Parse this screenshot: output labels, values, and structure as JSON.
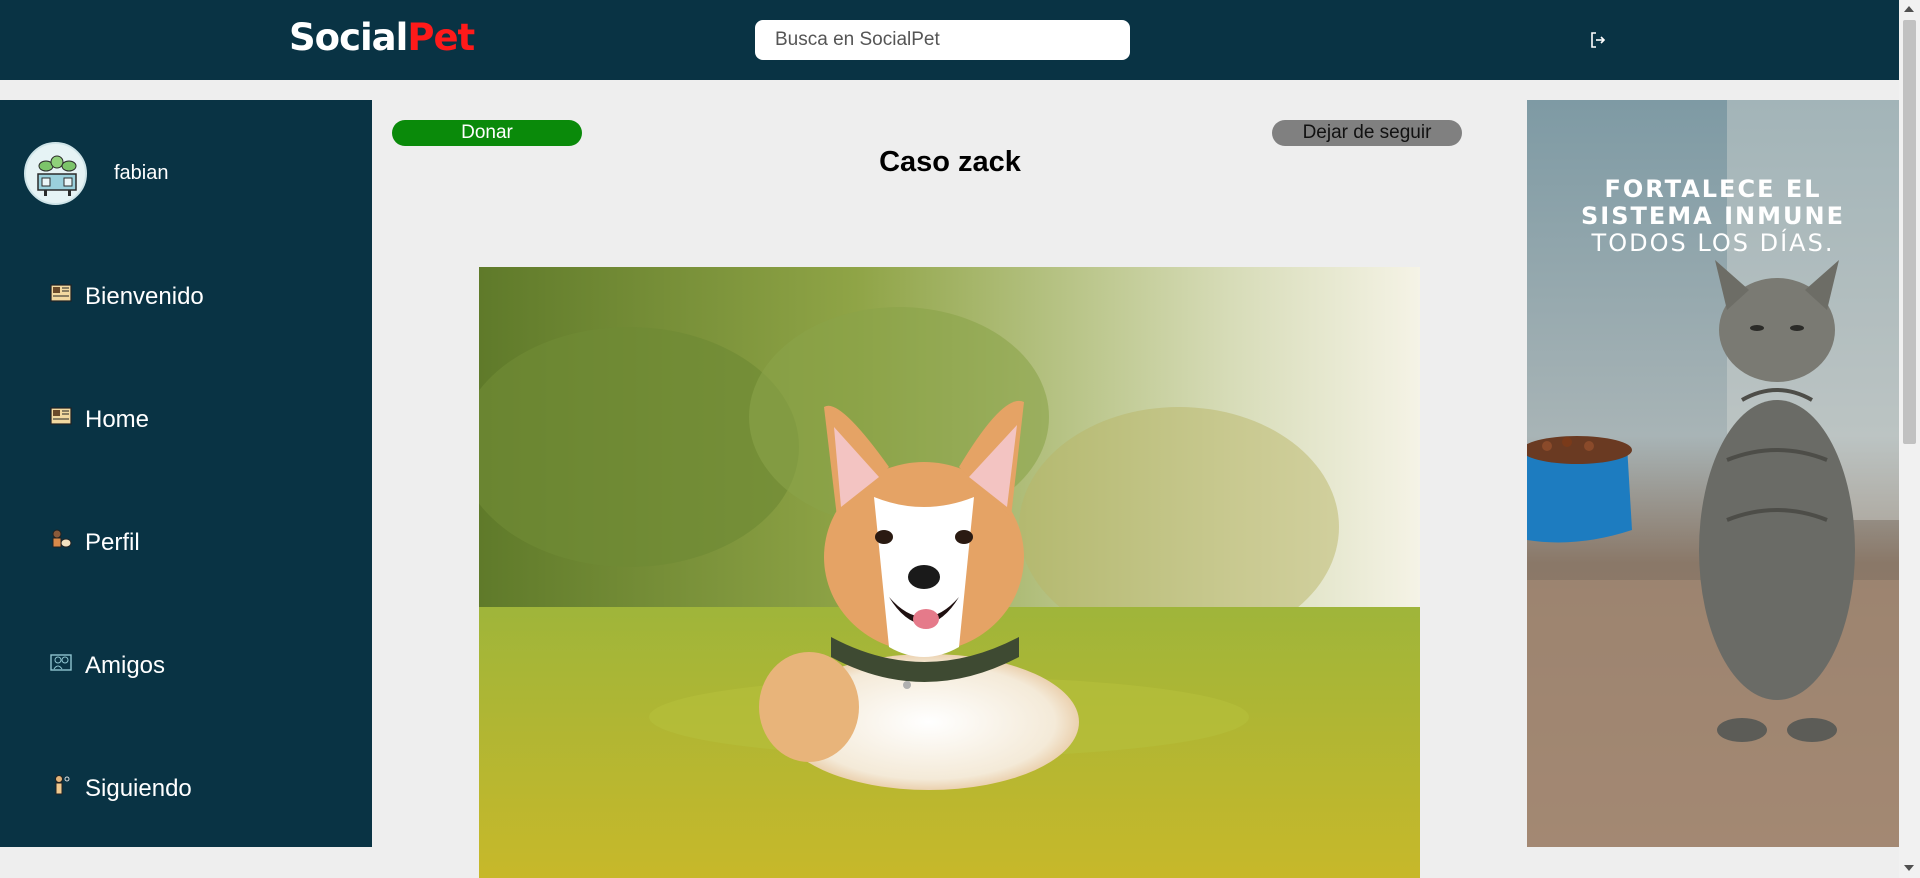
{
  "header": {
    "brand_part1": "Social",
    "brand_part2": "Pet",
    "search_placeholder": "Busca en SocialPet",
    "logout_icon": "logout-icon",
    "bg_color": "#093344"
  },
  "sidebar": {
    "username": "fabian",
    "items": [
      {
        "label": "Bienvenido",
        "icon": "newspaper-icon"
      },
      {
        "label": "Home",
        "icon": "newspaper-icon"
      },
      {
        "label": "Perfil",
        "icon": "person-pet-icon"
      },
      {
        "label": "Amigos",
        "icon": "friends-icon"
      },
      {
        "label": "Siguiendo",
        "icon": "following-icon"
      }
    ]
  },
  "post": {
    "donate_label": "Donar",
    "unfollow_label": "Dejar de seguir",
    "title": "Caso zack",
    "donate_color": "#0a8a0a",
    "unfollow_color": "#808080"
  },
  "ad": {
    "line1": "FORTALECE EL",
    "line2": "SISTEMA INMUNE",
    "line3": "TODOS LOS DÍAS."
  }
}
